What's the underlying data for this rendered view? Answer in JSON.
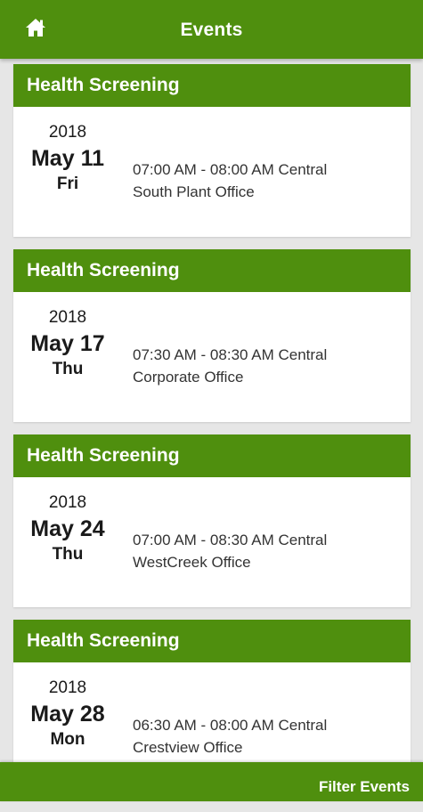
{
  "app_bar": {
    "title": "Events",
    "home_icon": "home-icon"
  },
  "events": [
    {
      "title": "Health Screening",
      "year": "2018",
      "month_day": "May 11",
      "weekday": "Fri",
      "time": "07:00 AM - 08:00 AM Central",
      "location": "South Plant Office"
    },
    {
      "title": "Health Screening",
      "year": "2018",
      "month_day": "May 17",
      "weekday": "Thu",
      "time": "07:30 AM - 08:30 AM Central",
      "location": "Corporate Office"
    },
    {
      "title": "Health Screening",
      "year": "2018",
      "month_day": "May 24",
      "weekday": "Thu",
      "time": "07:00 AM - 08:30 AM Central",
      "location": "WestCreek Office"
    },
    {
      "title": "Health Screening",
      "year": "2018",
      "month_day": "May 28",
      "weekday": "Mon",
      "time": "06:30 AM - 08:00 AM Central",
      "location": "Crestview Office"
    }
  ],
  "bottom_bar": {
    "filter_label": "Filter Events"
  },
  "colors": {
    "brand_green": "#4f8f0e",
    "background": "#e6e6e6",
    "card": "#ffffff"
  }
}
